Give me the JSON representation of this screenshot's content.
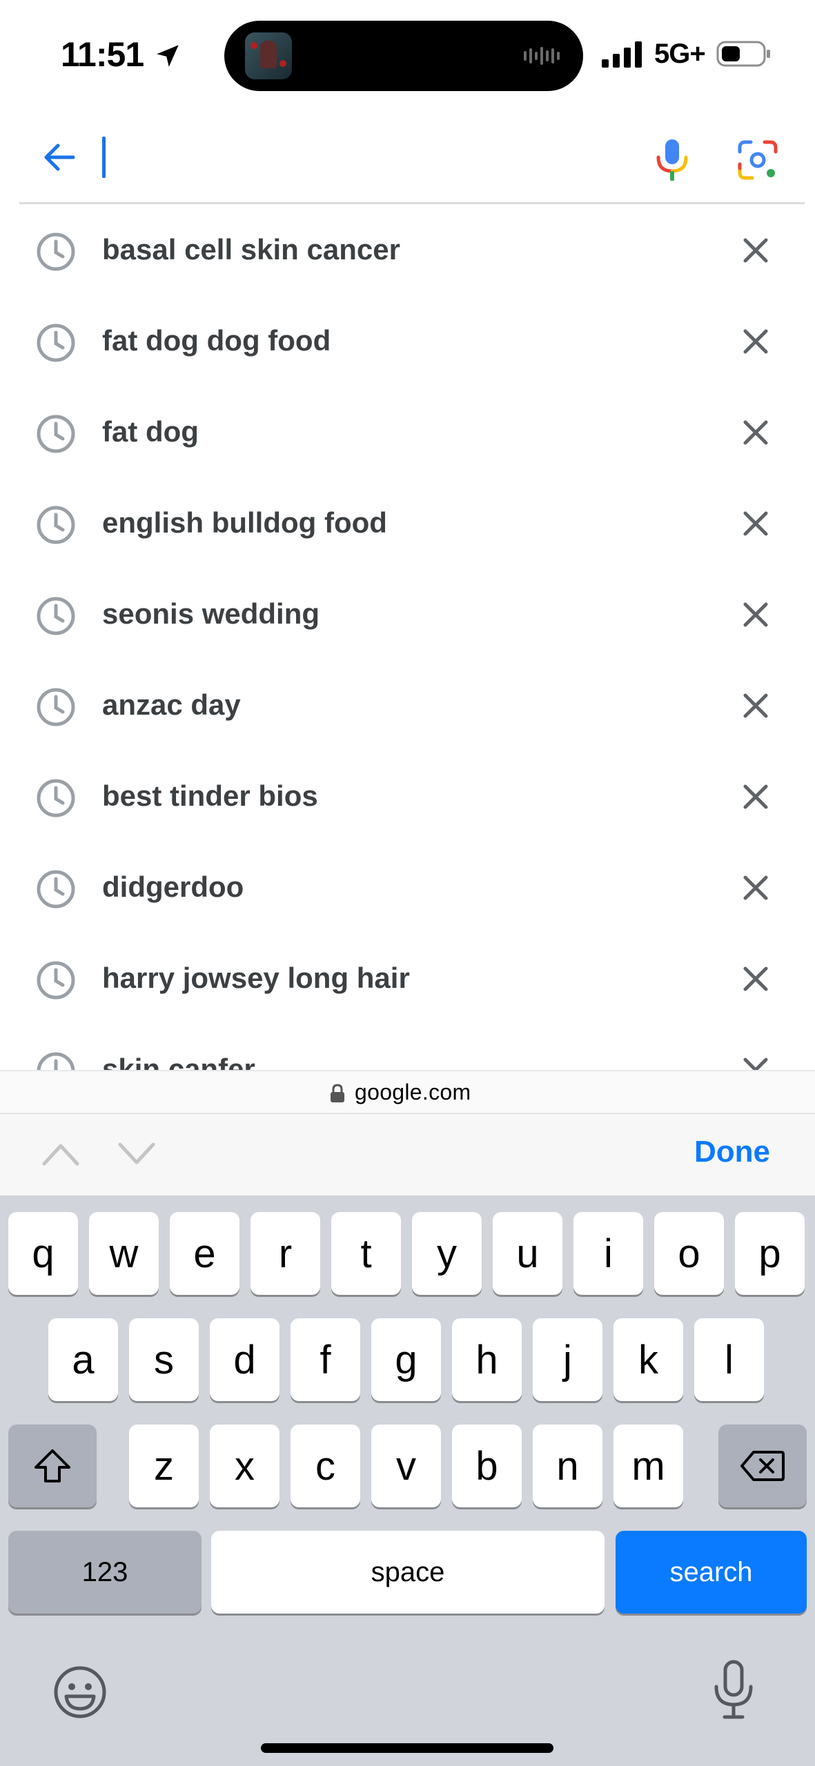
{
  "status_bar": {
    "time": "11:51",
    "network": "5G+"
  },
  "search": {
    "value": "",
    "placeholder": ""
  },
  "suggestions": [
    {
      "text": "basal cell skin cancer"
    },
    {
      "text": "fat dog dog food"
    },
    {
      "text": "fat dog"
    },
    {
      "text": "english bulldog food"
    },
    {
      "text": "seonis wedding"
    },
    {
      "text": "anzac day"
    },
    {
      "text": "best tinder bios"
    },
    {
      "text": "didgerdoo"
    },
    {
      "text": "harry jowsey long hair"
    },
    {
      "text": "skin canfer"
    }
  ],
  "url_bar": {
    "domain": "google.com"
  },
  "accessory": {
    "done_label": "Done"
  },
  "keyboard": {
    "row1": [
      "q",
      "w",
      "e",
      "r",
      "t",
      "y",
      "u",
      "i",
      "o",
      "p"
    ],
    "row2": [
      "a",
      "s",
      "d",
      "f",
      "g",
      "h",
      "j",
      "k",
      "l"
    ],
    "row3": [
      "z",
      "x",
      "c",
      "v",
      "b",
      "n",
      "m"
    ],
    "numbers_label": "123",
    "space_label": "space",
    "search_label": "search"
  },
  "colors": {
    "accent": "#1a73e8",
    "keyboard_bg": "#d1d4da",
    "search_key": "#0a7aff"
  }
}
